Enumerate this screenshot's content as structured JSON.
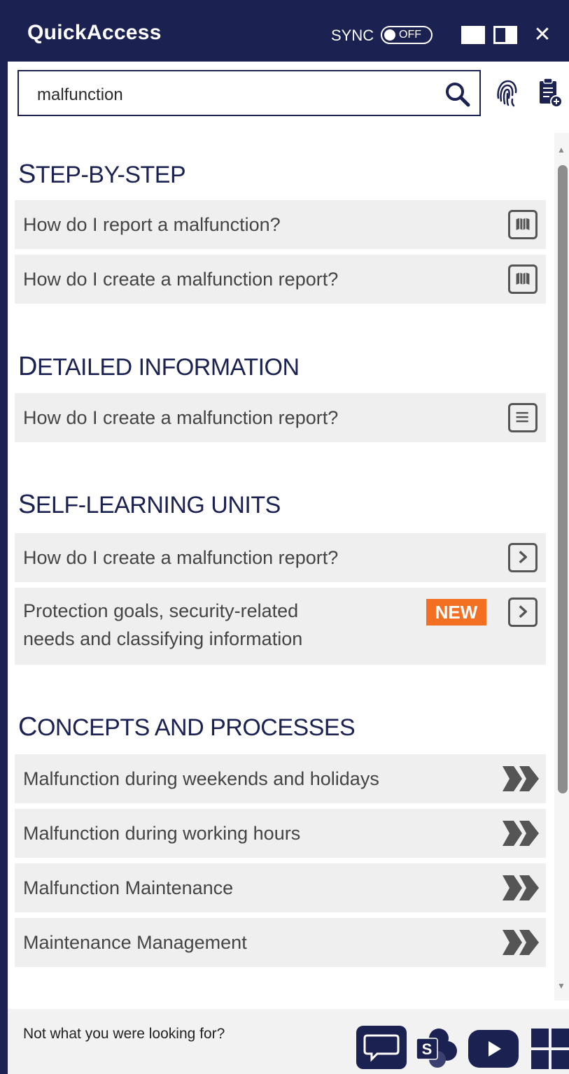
{
  "app": {
    "title": "QuickAccess"
  },
  "sync": {
    "label": "SYNC",
    "state": "OFF"
  },
  "search": {
    "value": "malfunction"
  },
  "sections": [
    {
      "first": "S",
      "rest": "TEP-BY-STEP",
      "items": [
        {
          "label": "How do I report a malfunction?",
          "icon": "book-icon"
        },
        {
          "label": "How do I create a malfunction report?",
          "icon": "book-icon"
        }
      ]
    },
    {
      "first": "D",
      "rest": "ETAILED INFORMATION",
      "items": [
        {
          "label": "How do I create a malfunction report?",
          "icon": "document-icon"
        }
      ]
    },
    {
      "first": "S",
      "rest": "ELF-LEARNING UNITS",
      "items": [
        {
          "label": "How do I create a malfunction report?",
          "icon": "chevron-right-icon"
        },
        {
          "label_line1": "Protection goals, security-related",
          "label_line2": "needs and classifying information",
          "badge": "NEW",
          "icon": "chevron-right-icon"
        }
      ]
    },
    {
      "first": "C",
      "rest": "ONCEPTS AND PROCESSES",
      "items": [
        {
          "label": "Malfunction during weekends and holidays",
          "icon": "double-chevron-icon"
        },
        {
          "label": "Malfunction during working hours",
          "icon": "double-chevron-icon"
        },
        {
          "label": "Malfunction Maintenance",
          "icon": "double-chevron-icon"
        },
        {
          "label": "Maintenance Management",
          "icon": "double-chevron-icon"
        }
      ]
    }
  ],
  "footer": {
    "text": "Not what you were looking for?"
  },
  "colors": {
    "navy": "#1b2151",
    "accent_orange": "#f36f21",
    "row_bg": "#efefef"
  }
}
